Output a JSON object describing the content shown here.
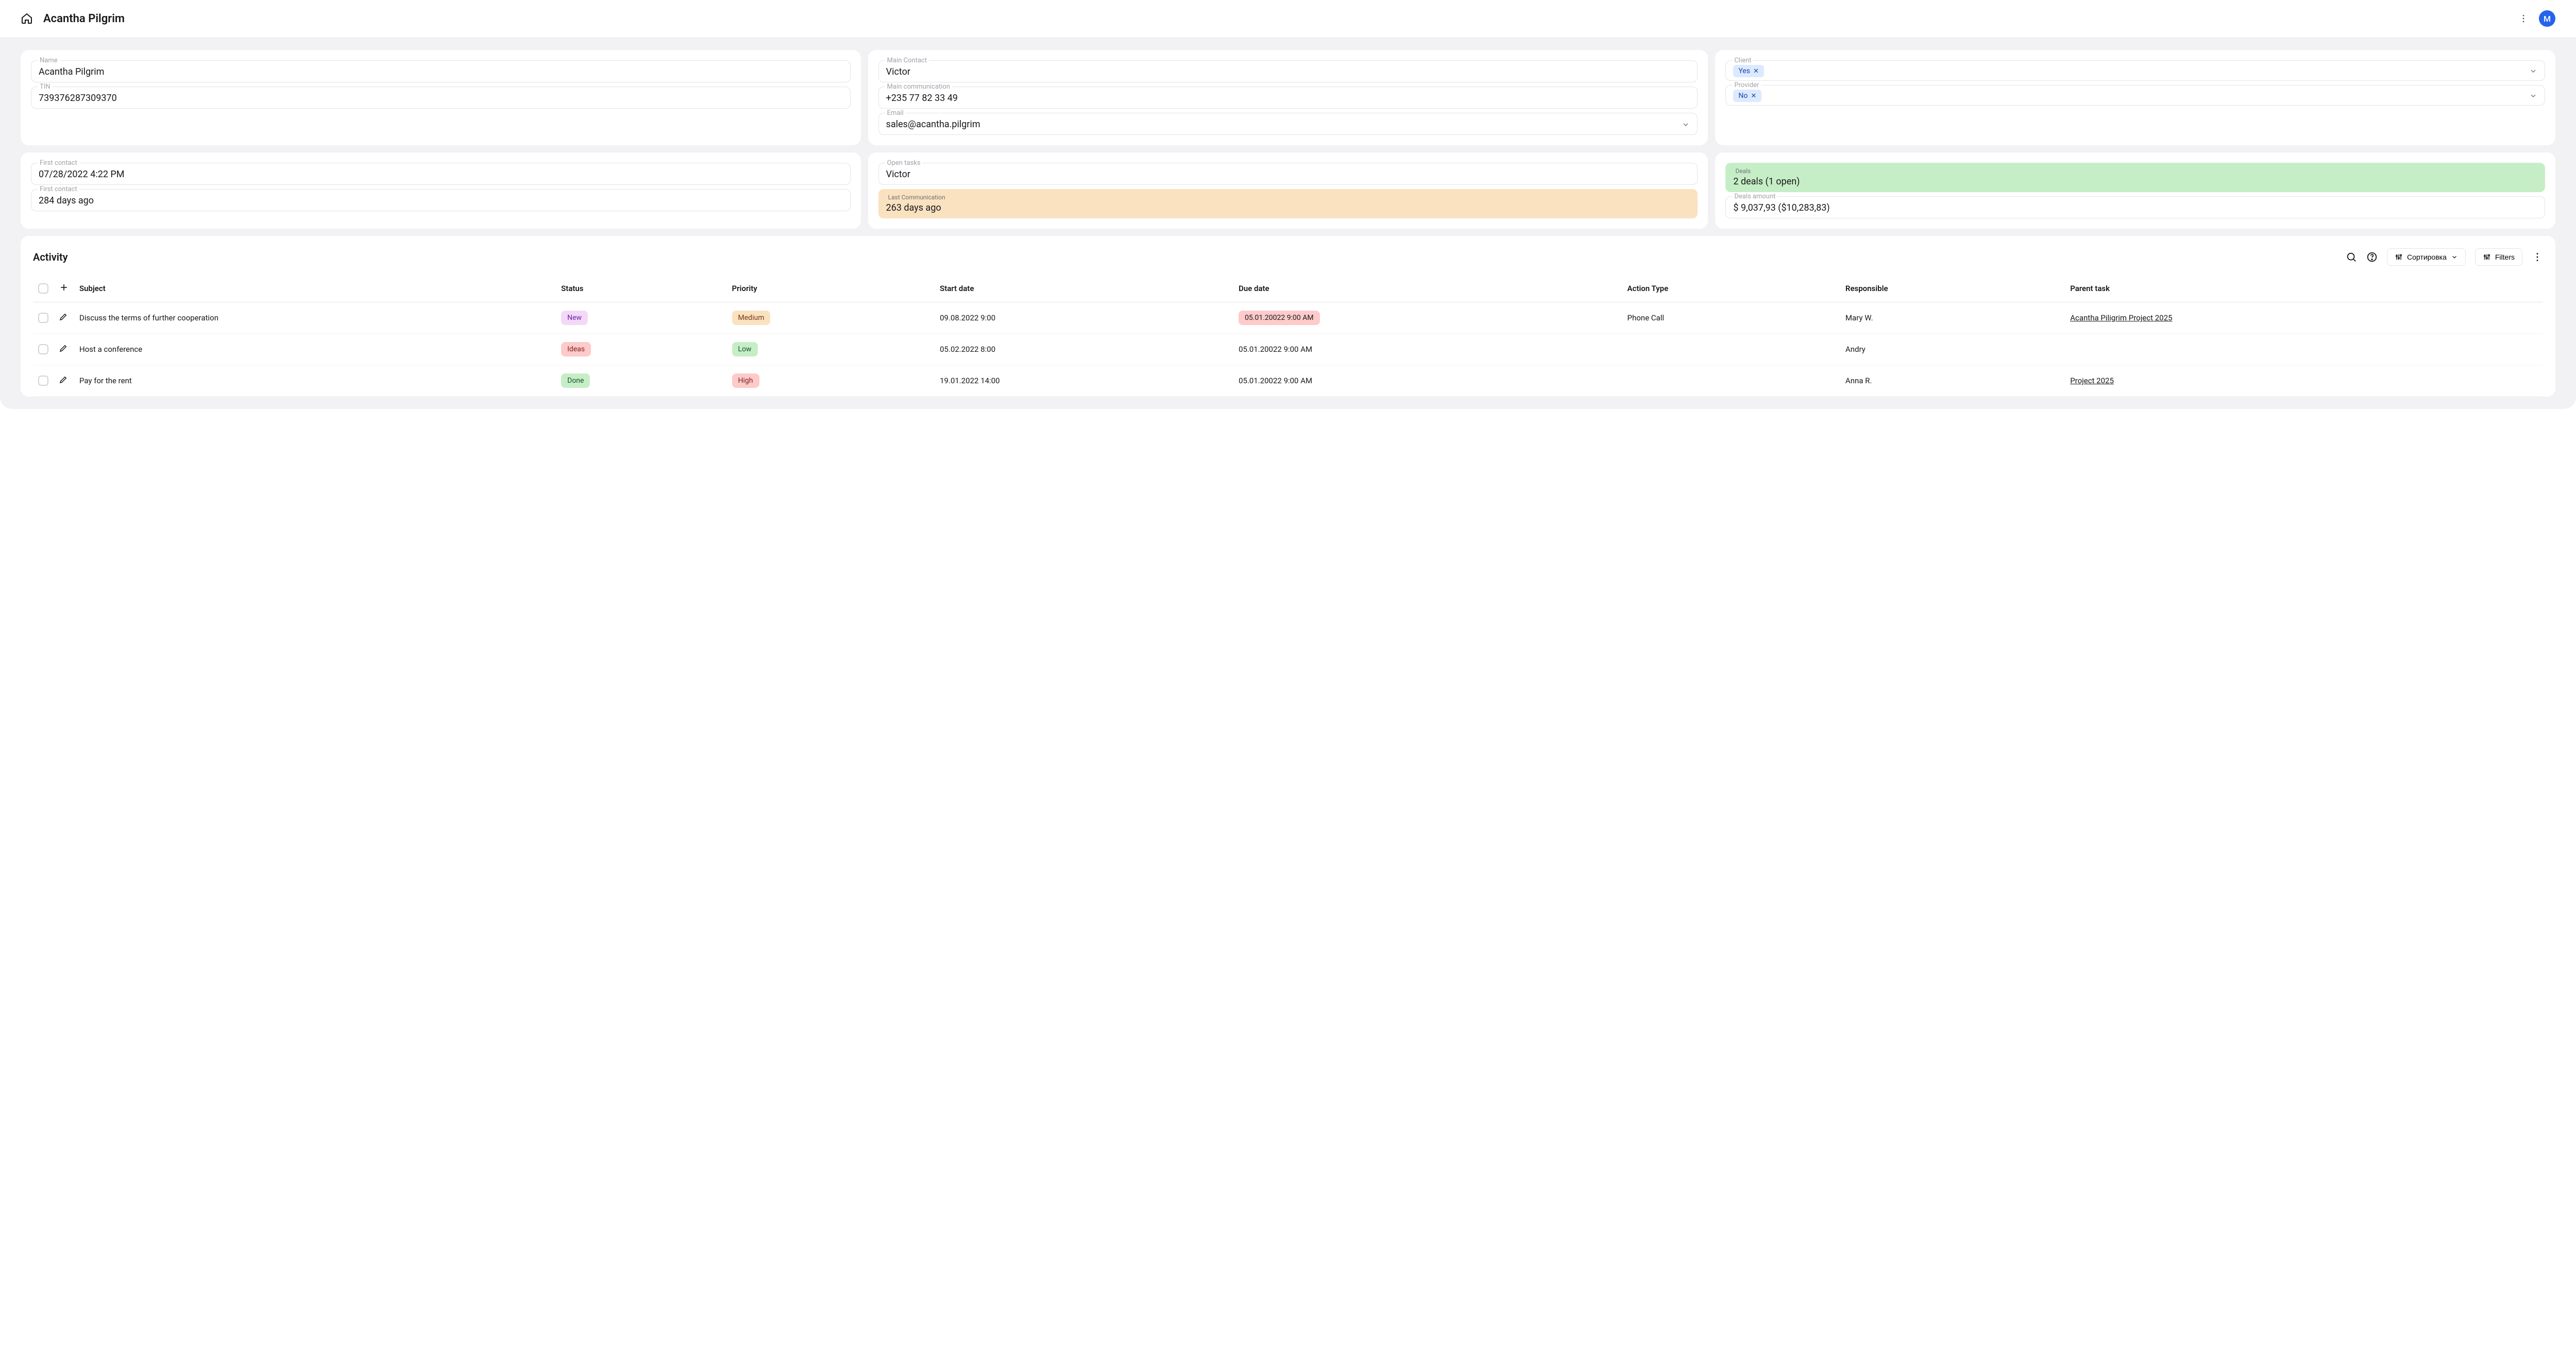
{
  "header": {
    "title": "Acantha Pilgrim",
    "avatar_initial": "M"
  },
  "cards": {
    "identity": {
      "name_label": "Name",
      "name_value": "Acantha Pilgrim",
      "tin_label": "TIN",
      "tin_value": "739376287309370"
    },
    "contact": {
      "main_contact_label": "Main Contact",
      "main_contact_value": "Victor",
      "main_comm_label": "Main communication",
      "main_comm_value": "+235 77 82 33 49",
      "email_label": "Email",
      "email_value": "sales@acantha.pilgrim"
    },
    "flags": {
      "client_label": "Client",
      "client_value": "Yes",
      "provider_label": "Provider",
      "provider_value": "No"
    },
    "timing": {
      "first_contact_label": "First contact",
      "first_contact_value": "07/28/2022 4:22 PM",
      "first_contact_ago_label": "First contact",
      "first_contact_ago_value": "284 days ago"
    },
    "tasks": {
      "open_tasks_label": "Open tasks",
      "open_tasks_value": "Victor",
      "last_comm_label": "Last Communication",
      "last_comm_value": "263 days ago"
    },
    "deals": {
      "deals_label": "Deals",
      "deals_value": "2 deals (1 open)",
      "amount_label": "Deals amount",
      "amount_value": "$ 9,037,93 ($10,283,83)"
    }
  },
  "activity": {
    "title": "Activity",
    "sort_label": "Сортировка",
    "filters_label": "Filters",
    "columns": {
      "subject": "Subject",
      "status": "Status",
      "priority": "Priority",
      "start_date": "Start date",
      "due_date": "Due date",
      "action_type": "Action Type",
      "responsible": "Responsible",
      "parent_task": "Parent task"
    },
    "rows": [
      {
        "subject": "Discuss the terms of further cooperation",
        "status": "New",
        "status_class": "new",
        "priority": "Medium",
        "priority_class": "medium",
        "start_date": "09.08.2022 9:00",
        "due_date": "05.01.20022 9:00 AM",
        "due_highlight": true,
        "action_type": "Phone Call",
        "responsible": "Mary W.",
        "parent_task": "Acantha Piligrim Project 2025"
      },
      {
        "subject": "Host a conference",
        "status": "Ideas",
        "status_class": "ideas",
        "priority": "Low",
        "priority_class": "low",
        "start_date": "05.02.2022 8:00",
        "due_date": "05.01.20022 9:00 AM",
        "due_highlight": false,
        "action_type": "",
        "responsible": "Andry",
        "parent_task": ""
      },
      {
        "subject": "Pay for the rent",
        "status": "Done",
        "status_class": "done",
        "priority": "High",
        "priority_class": "high",
        "start_date": "19.01.2022 14:00",
        "due_date": "05.01.20022 9:00 AM",
        "due_highlight": false,
        "action_type": "",
        "responsible": "Anna R.",
        "parent_task": "Project 2025"
      }
    ]
  }
}
